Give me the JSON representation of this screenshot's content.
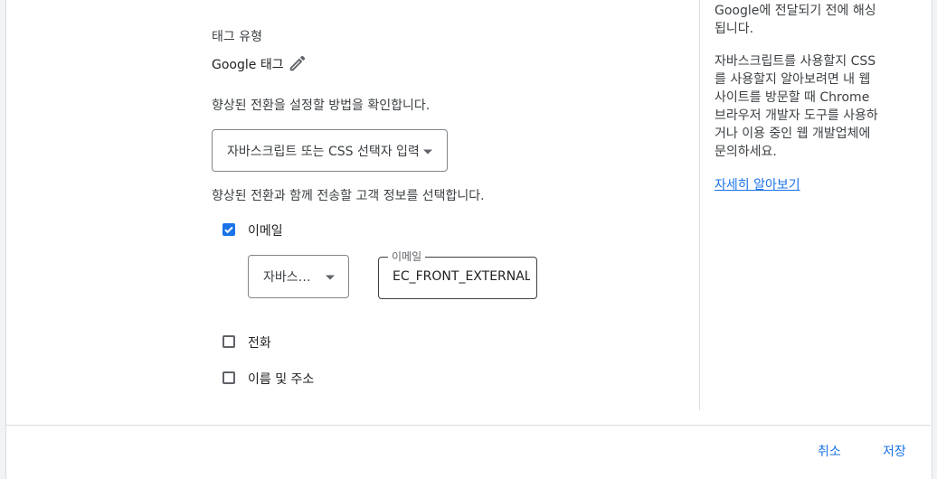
{
  "tag_section": {
    "tag_type_label": "태그 유형",
    "tag_type_value": "Google 태그"
  },
  "conversion_method": {
    "question": "향상된 전환을 설정할 방법을 확인합니다.",
    "selected": "자바스크립트 또는 CSS 선택자 입력"
  },
  "customer_info": {
    "question": "향상된 전환과 함께 전송할 고객 정보를 선택합니다.",
    "email": {
      "label": "이메일",
      "checked": true,
      "method_selected": "자바스크립트 변수",
      "field_label": "이메일",
      "field_value": "EC_FRONT_EXTERNAL"
    },
    "phone": {
      "label": "전화",
      "checked": false
    },
    "name_address": {
      "label": "이름 및 주소",
      "checked": false
    }
  },
  "sidebar": {
    "paragraph1": "Google에 전달되기 전에 해싱됩니다.",
    "paragraph2": "자바스크립트를 사용할지 CSS를 사용할지 알아보려면 내 웹사이트를 방문할 때 Chrome 브라우저 개발자 도구를 사용하거나 이용 중인 웹 개발업체에 문의하세요.",
    "learn_more": "자세히 알아보기"
  },
  "footer": {
    "cancel": "취소",
    "save": "저장"
  },
  "colors": {
    "accent": "#1a73e8",
    "text": "#3c4043",
    "divider": "#dadce0"
  },
  "icons": {
    "edit": "pencil-icon",
    "dropdown": "caret-down-icon",
    "check": "check-icon"
  }
}
